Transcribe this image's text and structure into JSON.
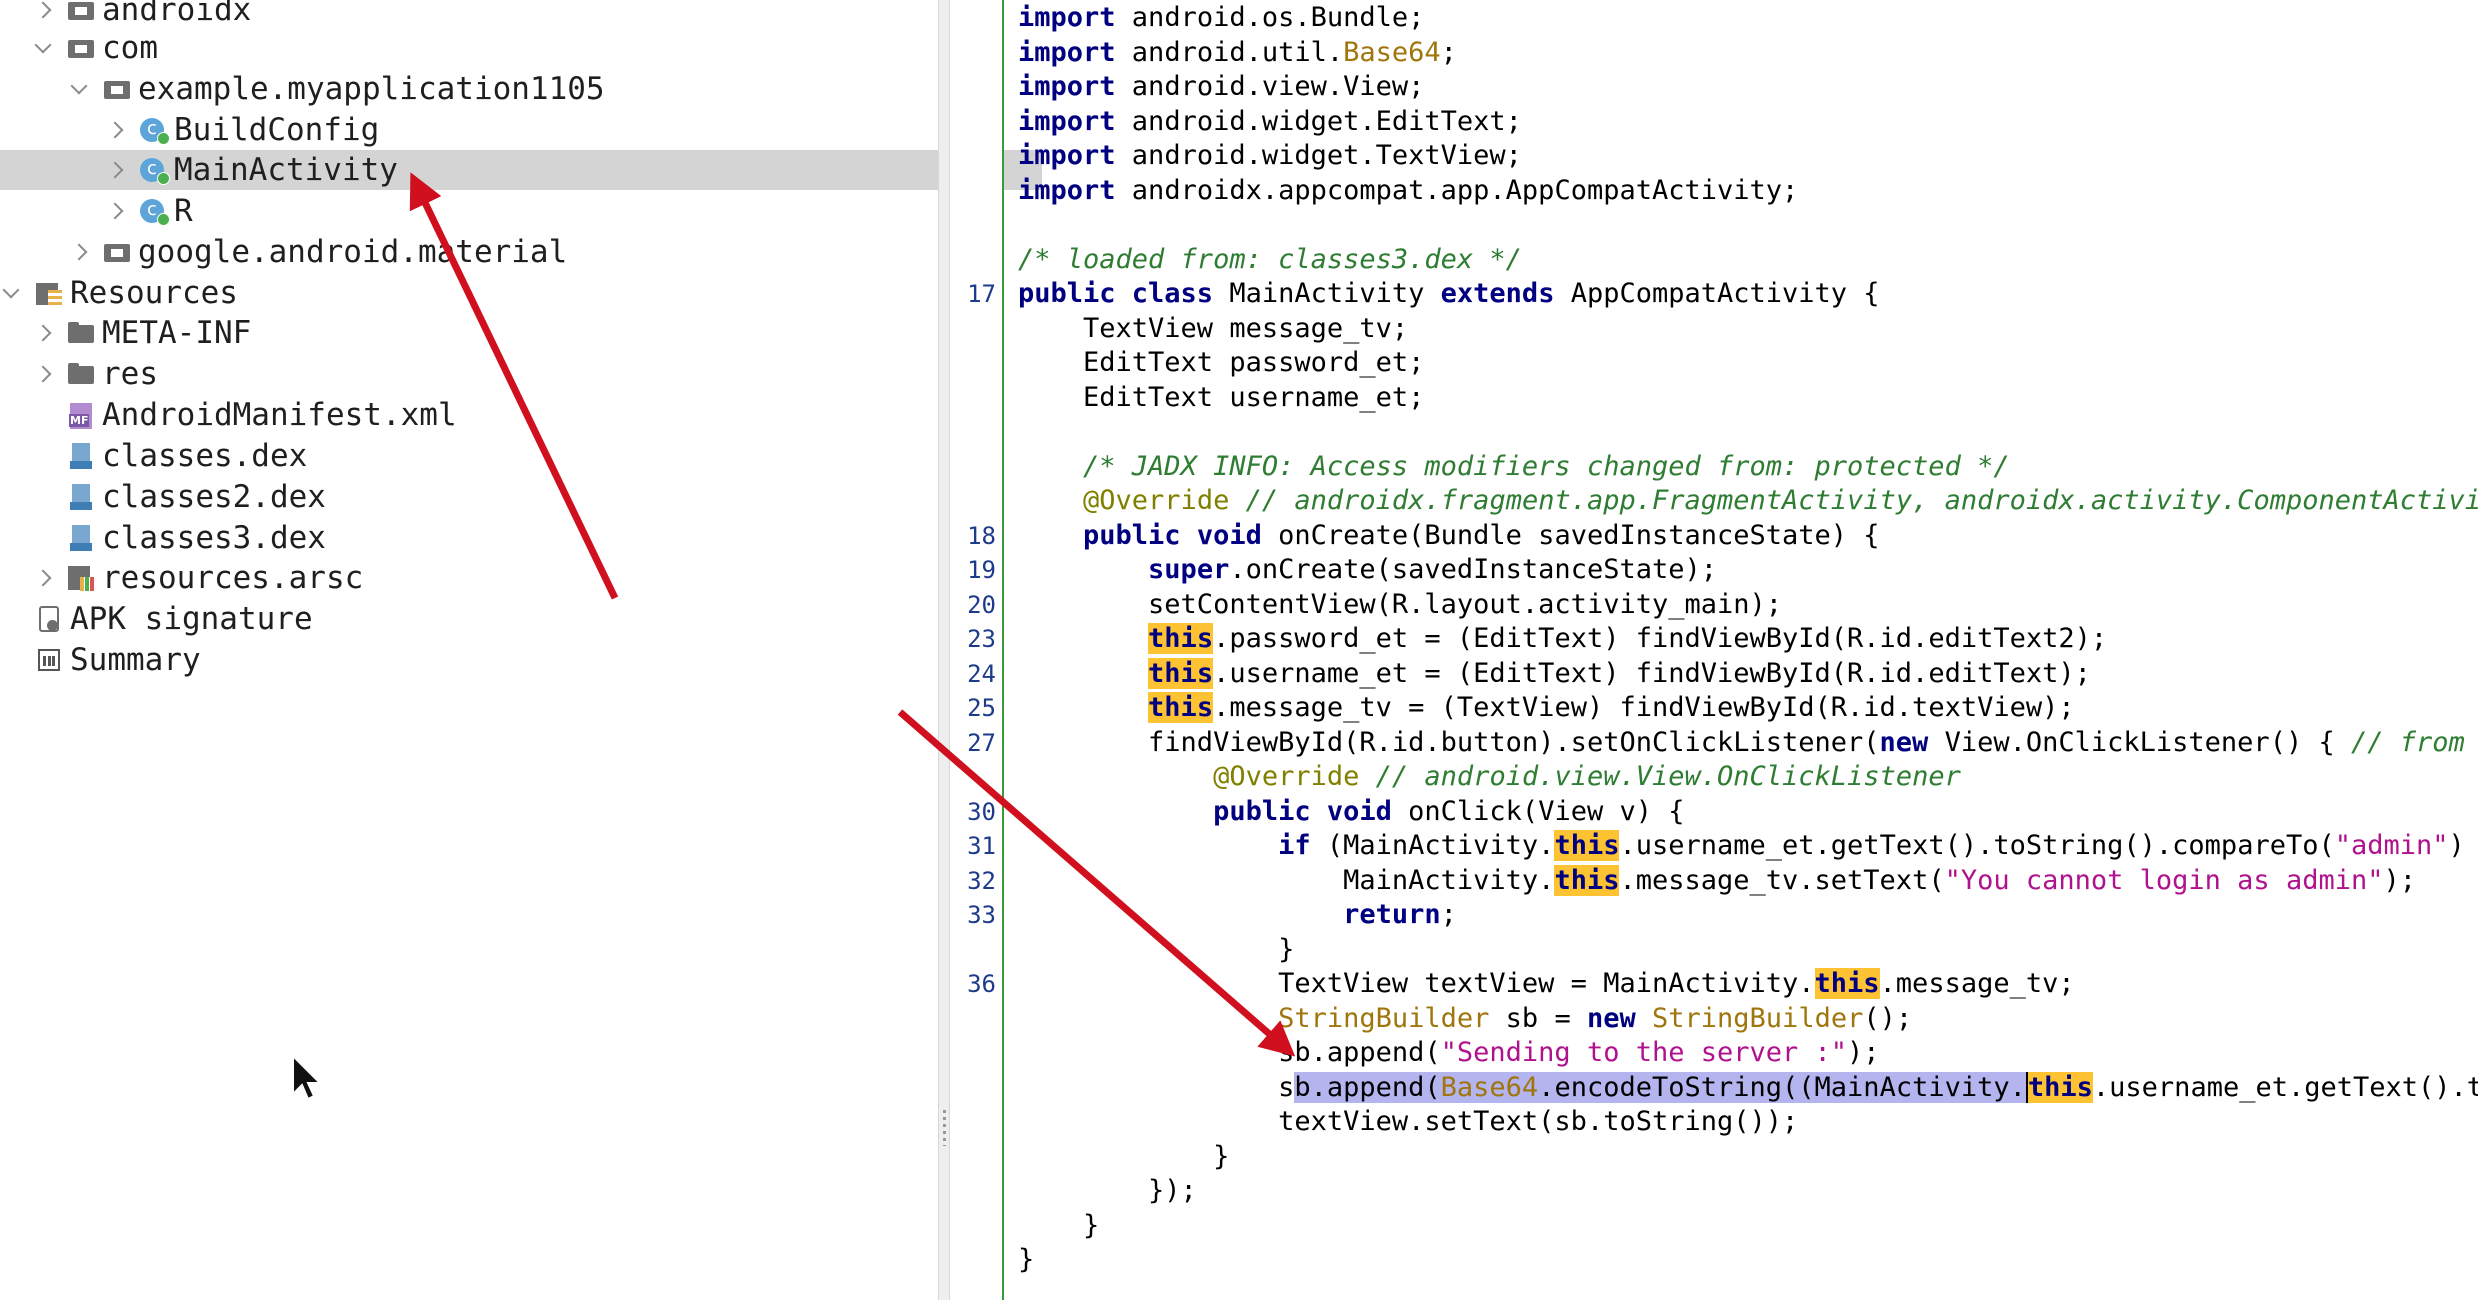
{
  "tree": {
    "items": [
      {
        "label": "androidx",
        "icon": "package-icon",
        "expand": "collapsed"
      },
      {
        "label": "com",
        "icon": "package-icon",
        "expand": "expanded"
      },
      {
        "label": "example.myapplication1105",
        "icon": "package-icon",
        "expand": "expanded"
      },
      {
        "label": "BuildConfig",
        "icon": "class-icon",
        "expand": "collapsed"
      },
      {
        "label": "MainActivity",
        "icon": "class-icon",
        "expand": "collapsed",
        "selected": true
      },
      {
        "label": "R",
        "icon": "class-icon",
        "expand": "collapsed"
      },
      {
        "label": "google.android.material",
        "icon": "package-icon",
        "expand": "collapsed"
      },
      {
        "label": "Resources",
        "icon": "resources-icon",
        "expand": "expanded"
      },
      {
        "label": "META-INF",
        "icon": "folder-icon",
        "expand": "collapsed"
      },
      {
        "label": "res",
        "icon": "folder-icon",
        "expand": "collapsed"
      },
      {
        "label": "AndroidManifest.xml",
        "icon": "manifest-icon",
        "expand": "none"
      },
      {
        "label": "classes.dex",
        "icon": "dex-icon",
        "expand": "none"
      },
      {
        "label": "classes2.dex",
        "icon": "dex-icon",
        "expand": "none"
      },
      {
        "label": "classes3.dex",
        "icon": "dex-icon",
        "expand": "none"
      },
      {
        "label": "resources.arsc",
        "icon": "arsc-icon",
        "expand": "collapsed"
      },
      {
        "label": "APK signature",
        "icon": "signature-icon",
        "expand": "none"
      },
      {
        "label": "Summary",
        "icon": "summary-icon",
        "expand": "none"
      }
    ]
  },
  "editor": {
    "line_numbers": [
      "17",
      "18",
      "19",
      "20",
      "23",
      "24",
      "25",
      "27",
      "30",
      "31",
      "32",
      "33",
      "36"
    ],
    "lines": {
      "l0": [
        {
          "t": "import",
          "c": "kw"
        },
        {
          "t": " android.os.Bundle;"
        }
      ],
      "l1": [
        {
          "t": "import",
          "c": "kw"
        },
        {
          "t": " android.util."
        },
        {
          "t": "Base64",
          "c": "ty"
        },
        {
          "t": ";"
        }
      ],
      "l2": [
        {
          "t": "import",
          "c": "kw"
        },
        {
          "t": " android.view.View;"
        }
      ],
      "l3": [
        {
          "t": "import",
          "c": "kw"
        },
        {
          "t": " android.widget.EditText;"
        }
      ],
      "l4": [
        {
          "t": "import",
          "c": "kw"
        },
        {
          "t": " android.widget.TextView;"
        }
      ],
      "l5": [
        {
          "t": "import",
          "c": "kw"
        },
        {
          "t": " androidx.appcompat.app.AppCompatActivity;"
        }
      ],
      "l7": [
        {
          "t": "/* loaded from: classes3.dex */",
          "c": "cm"
        }
      ],
      "l8": [
        {
          "t": "public class",
          "c": "kw"
        },
        {
          "t": " MainActivity "
        },
        {
          "t": "extends",
          "c": "kw"
        },
        {
          "t": " AppCompatActivity {"
        }
      ],
      "l9": [
        {
          "t": "    TextView message_tv;"
        }
      ],
      "l10": [
        {
          "t": "    EditText password_et;"
        }
      ],
      "l11": [
        {
          "t": "    EditText username_et;"
        }
      ],
      "l13": [
        {
          "t": "    "
        },
        {
          "t": "/* JADX INFO: Access modifiers changed from: protected */",
          "c": "cm"
        }
      ],
      "l14": [
        {
          "t": "    "
        },
        {
          "t": "@Override",
          "c": "an"
        },
        {
          "t": " "
        },
        {
          "t": "// androidx.fragment.app.FragmentActivity, androidx.activity.ComponentActivi",
          "c": "cm"
        }
      ],
      "l15": [
        {
          "t": "    "
        },
        {
          "t": "public void",
          "c": "kw"
        },
        {
          "t": " onCreate(Bundle savedInstanceState) {"
        }
      ],
      "l16": [
        {
          "t": "        "
        },
        {
          "t": "super",
          "c": "kw"
        },
        {
          "t": ".onCreate(savedInstanceState);"
        }
      ],
      "l17": [
        {
          "t": "        setContentView(R.layout.activity_main);"
        }
      ],
      "l18": [
        {
          "t": "        "
        },
        {
          "t": "this",
          "c": "kw hl"
        },
        {
          "t": ".password_et = (EditText) findViewById(R.id.editText2);"
        }
      ],
      "l19": [
        {
          "t": "        "
        },
        {
          "t": "this",
          "c": "kw hl"
        },
        {
          "t": ".username_et = (EditText) findViewById(R.id.editText);"
        }
      ],
      "l20": [
        {
          "t": "        "
        },
        {
          "t": "this",
          "c": "kw hl"
        },
        {
          "t": ".message_tv = (TextView) findViewById(R.id.textView);"
        }
      ],
      "l21": [
        {
          "t": "        findViewById(R.id.button).setOnClickListener("
        },
        {
          "t": "new",
          "c": "kw"
        },
        {
          "t": " View.OnClickListener() { "
        },
        {
          "t": "// from",
          "c": "cm"
        }
      ],
      "l22": [
        {
          "t": "            "
        },
        {
          "t": "@Override",
          "c": "an"
        },
        {
          "t": " "
        },
        {
          "t": "// android.view.View.OnClickListener",
          "c": "cm"
        }
      ],
      "l23": [
        {
          "t": "            "
        },
        {
          "t": "public void",
          "c": "kw"
        },
        {
          "t": " onClick(View v) {"
        }
      ],
      "l24": [
        {
          "t": "                "
        },
        {
          "t": "if",
          "c": "kw"
        },
        {
          "t": " (MainActivity."
        },
        {
          "t": "this",
          "c": "kw hl"
        },
        {
          "t": ".username_et.getText().toString().compareTo("
        },
        {
          "t": "\"admin\"",
          "c": "str"
        },
        {
          "t": ")"
        }
      ],
      "l25": [
        {
          "t": "                    MainActivity."
        },
        {
          "t": "this",
          "c": "kw hl"
        },
        {
          "t": ".message_tv.setText("
        },
        {
          "t": "\"You cannot login as admin\"",
          "c": "str"
        },
        {
          "t": ");"
        }
      ],
      "l26": [
        {
          "t": "                    "
        },
        {
          "t": "return",
          "c": "kw"
        },
        {
          "t": ";"
        }
      ],
      "l27": [
        {
          "t": "                }"
        }
      ],
      "l28": [
        {
          "t": "                TextView textView = MainActivity."
        },
        {
          "t": "this",
          "c": "kw hl"
        },
        {
          "t": ".message_tv;"
        }
      ],
      "l29": [
        {
          "t": "                "
        },
        {
          "t": "StringBuilder",
          "c": "ty"
        },
        {
          "t": " sb = "
        },
        {
          "t": "new",
          "c": "kw"
        },
        {
          "t": " "
        },
        {
          "t": "StringBuilder",
          "c": "ty"
        },
        {
          "t": "();"
        }
      ],
      "l30": [
        {
          "t": "                sb.append("
        },
        {
          "t": "\"Sending to the server :\"",
          "c": "str"
        },
        {
          "t": ");"
        }
      ],
      "l31": [
        {
          "t": "                s"
        },
        {
          "t": "b.append(",
          "c": "sel"
        },
        {
          "t": "Base64",
          "c": "ty sel"
        },
        {
          "t": ".encodeToString((MainActivity.",
          "c": "sel"
        },
        {
          "t": "this",
          "c": "kw hl caret"
        },
        {
          "t": ".username_et.getText().t"
        }
      ],
      "l32": [
        {
          "t": "                textView.setText(sb.toString());"
        }
      ],
      "l33": [
        {
          "t": "            }"
        }
      ],
      "l34": [
        {
          "t": "        });"
        }
      ],
      "l35": [
        {
          "t": "    }"
        }
      ],
      "l36": [
        {
          "t": "}"
        }
      ]
    }
  }
}
